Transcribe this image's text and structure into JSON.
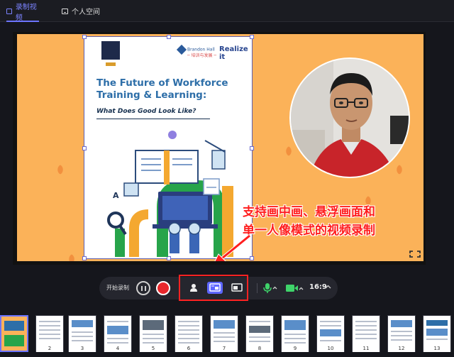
{
  "tabs": [
    {
      "label": "录制视频",
      "active": true
    },
    {
      "label": "个人空间",
      "active": false
    }
  ],
  "slide": {
    "doc": {
      "brand": "Brandon Hall",
      "brand_sub": "─ 培训与发展 ─",
      "partner": "Realize it",
      "title_line1": "The Future of Workforce",
      "title_line2": "Training & Learning:",
      "subtitle": "What Does Good Look Like?",
      "illus_letter": "A"
    },
    "caption_line1": "支持画中画、悬浮画面和",
    "caption_line2": "单一人像模式的视频录制",
    "background_color": "#fbb259"
  },
  "controls": {
    "start_label": "开始录制",
    "modes": [
      {
        "icon": "person-icon",
        "selected": false
      },
      {
        "icon": "picture-in-picture-icon",
        "selected": true
      },
      {
        "icon": "floating-window-icon",
        "selected": false
      }
    ],
    "aspect_ratio": "16:9"
  },
  "thumbnails": [
    {
      "num": ""
    },
    {
      "num": "2"
    },
    {
      "num": "3"
    },
    {
      "num": "4"
    },
    {
      "num": "5"
    },
    {
      "num": "6"
    },
    {
      "num": "7"
    },
    {
      "num": "8"
    },
    {
      "num": "9"
    },
    {
      "num": "10"
    },
    {
      "num": "11"
    },
    {
      "num": "12"
    },
    {
      "num": "13"
    }
  ],
  "colors": {
    "accent": "#6c74ff",
    "record": "#e8272c",
    "highlight": "#ff2222"
  }
}
